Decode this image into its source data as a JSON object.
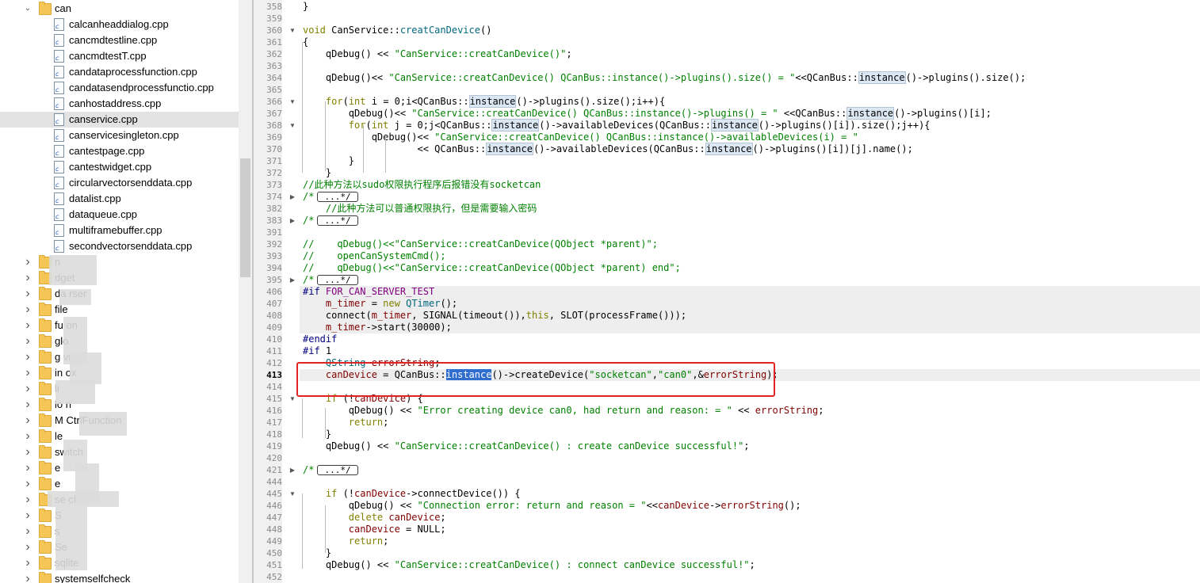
{
  "tree": {
    "root": {
      "label": "can",
      "expanded": true
    },
    "files": [
      "calcanheaddialog.cpp",
      "cancmdtestline.cpp",
      "cancmdtestT.cpp",
      "candataprocessfunction.cpp",
      "candatasendprocessfunctio.cpp",
      "canhostaddress.cpp",
      "canservice.cpp",
      "canservicesingleton.cpp",
      "cantestpage.cpp",
      "cantestwidget.cpp",
      "circularvectorsenddata.cpp",
      "datalist.cpp",
      "dataqueue.cpp",
      "multiframebuffer.cpp",
      "secondvectorsenddata.cpp"
    ],
    "selected_index": 6,
    "folders": [
      "n",
      "dget",
      "da      rser",
      "file",
      "fu     on",
      "glo",
      "g          view",
      "in    ox",
      "li",
      "lo     n",
      "M              CtrlFunction",
      "le",
      "switch",
      "e",
      "e",
      "se      chet",
      "S",
      "s",
      "Se",
      "sqlite",
      "systemselfcheck"
    ]
  },
  "editor": {
    "lines": [
      {
        "n": "358",
        "t": "}"
      },
      {
        "n": "359",
        "t": ""
      },
      {
        "n": "360",
        "t": "void CanService::creatCanDevice()"
      },
      {
        "n": "361",
        "t": "{"
      },
      {
        "n": "362",
        "t": "    qDebug() << \"CanService::creatCanDevice()\";"
      },
      {
        "n": "363",
        "t": ""
      },
      {
        "n": "364",
        "t": "    qDebug()<< \"CanService::creatCanDevice() QCanBus::instance()->plugins().size() = \"<<QCanBus::instance()->plugins().size();"
      },
      {
        "n": "365",
        "t": ""
      },
      {
        "n": "366",
        "t": "    for(int i = 0;i<QCanBus::instance()->plugins().size();i++){"
      },
      {
        "n": "367",
        "t": "        qDebug()<< \"CanService::creatCanDevice() QCanBus::instance()->plugins() = \" <<QCanBus::instance()->plugins()[i];"
      },
      {
        "n": "368",
        "t": "        for(int j = 0;j<QCanBus::instance()->availableDevices(QCanBus::instance()->plugins()[i]).size();j++){"
      },
      {
        "n": "369",
        "t": "            qDebug()<< \"CanService::creatCanDevice() QCanBus::instance()->availableDevices(i) = \""
      },
      {
        "n": "370",
        "t": "                    << QCanBus::instance()->availableDevices(QCanBus::instance()->plugins()[i])[j].name();"
      },
      {
        "n": "371",
        "t": "        }"
      },
      {
        "n": "372",
        "t": "    }"
      },
      {
        "n": "373",
        "t": "//此种方法以sudo权限执行程序后报错没有socketcan"
      },
      {
        "n": "374",
        "t": "/* ...*/"
      },
      {
        "n": "382",
        "t": "    //此种方法可以普通权限执行，但是需要输入密码"
      },
      {
        "n": "383",
        "t": "/* ...*/"
      },
      {
        "n": "391",
        "t": ""
      },
      {
        "n": "392",
        "t": "//    qDebug()<<\"CanService::creatCanDevice(QObject *parent)\";"
      },
      {
        "n": "393",
        "t": "//    openCanSystemCmd();"
      },
      {
        "n": "394",
        "t": "//    qDebug()<<\"CanService::creatCanDevice(QObject *parent) end\";"
      },
      {
        "n": "395",
        "t": "/* ...*/"
      },
      {
        "n": "406",
        "t": "#if FOR_CAN_SERVER_TEST"
      },
      {
        "n": "407",
        "t": "    m_timer = new QTimer();"
      },
      {
        "n": "408",
        "t": "    connect(m_timer, SIGNAL(timeout()),this, SLOT(processFrame()));"
      },
      {
        "n": "409",
        "t": "    m_timer->start(30000);"
      },
      {
        "n": "410",
        "t": "#endif"
      },
      {
        "n": "411",
        "t": "#if 1"
      },
      {
        "n": "412",
        "t": "    QString errorString;"
      },
      {
        "n": "413",
        "t": "    canDevice = QCanBus::instance()->createDevice(\"socketcan\",\"can0\",&errorString);"
      },
      {
        "n": "414",
        "t": ""
      },
      {
        "n": "415",
        "t": "    if (!canDevice) {"
      },
      {
        "n": "416",
        "t": "        qDebug() << \"Error creating device can0, had return and reason: = \" << errorString;"
      },
      {
        "n": "417",
        "t": "        return;"
      },
      {
        "n": "418",
        "t": "    }"
      },
      {
        "n": "419",
        "t": "    qDebug() << \"CanService::creatCanDevice() : create canDevice successful!\";"
      },
      {
        "n": "420",
        "t": ""
      },
      {
        "n": "421",
        "t": "/* ...*/"
      },
      {
        "n": "444",
        "t": ""
      },
      {
        "n": "445",
        "t": "    if (!canDevice->connectDevice()) {"
      },
      {
        "n": "446",
        "t": "        qDebug() << \"Connection error: return and reason = \"<<canDevice->errorString();"
      },
      {
        "n": "447",
        "t": "        delete canDevice;"
      },
      {
        "n": "448",
        "t": "        canDevice = NULL;"
      },
      {
        "n": "449",
        "t": "        return;"
      },
      {
        "n": "450",
        "t": "    }"
      },
      {
        "n": "451",
        "t": "    qDebug() << \"CanService::creatCanDevice() : connect canDevice successful!\";"
      },
      {
        "n": "452",
        "t": ""
      }
    ],
    "current_line": "413"
  },
  "colors": {
    "keyword": "#808000",
    "string": "#008000",
    "comment": "#008000",
    "function": "#00677c",
    "preprocessor": "#000080",
    "member": "#800000",
    "selection": "#2f6dcf",
    "annotation_box": "#e02323"
  }
}
